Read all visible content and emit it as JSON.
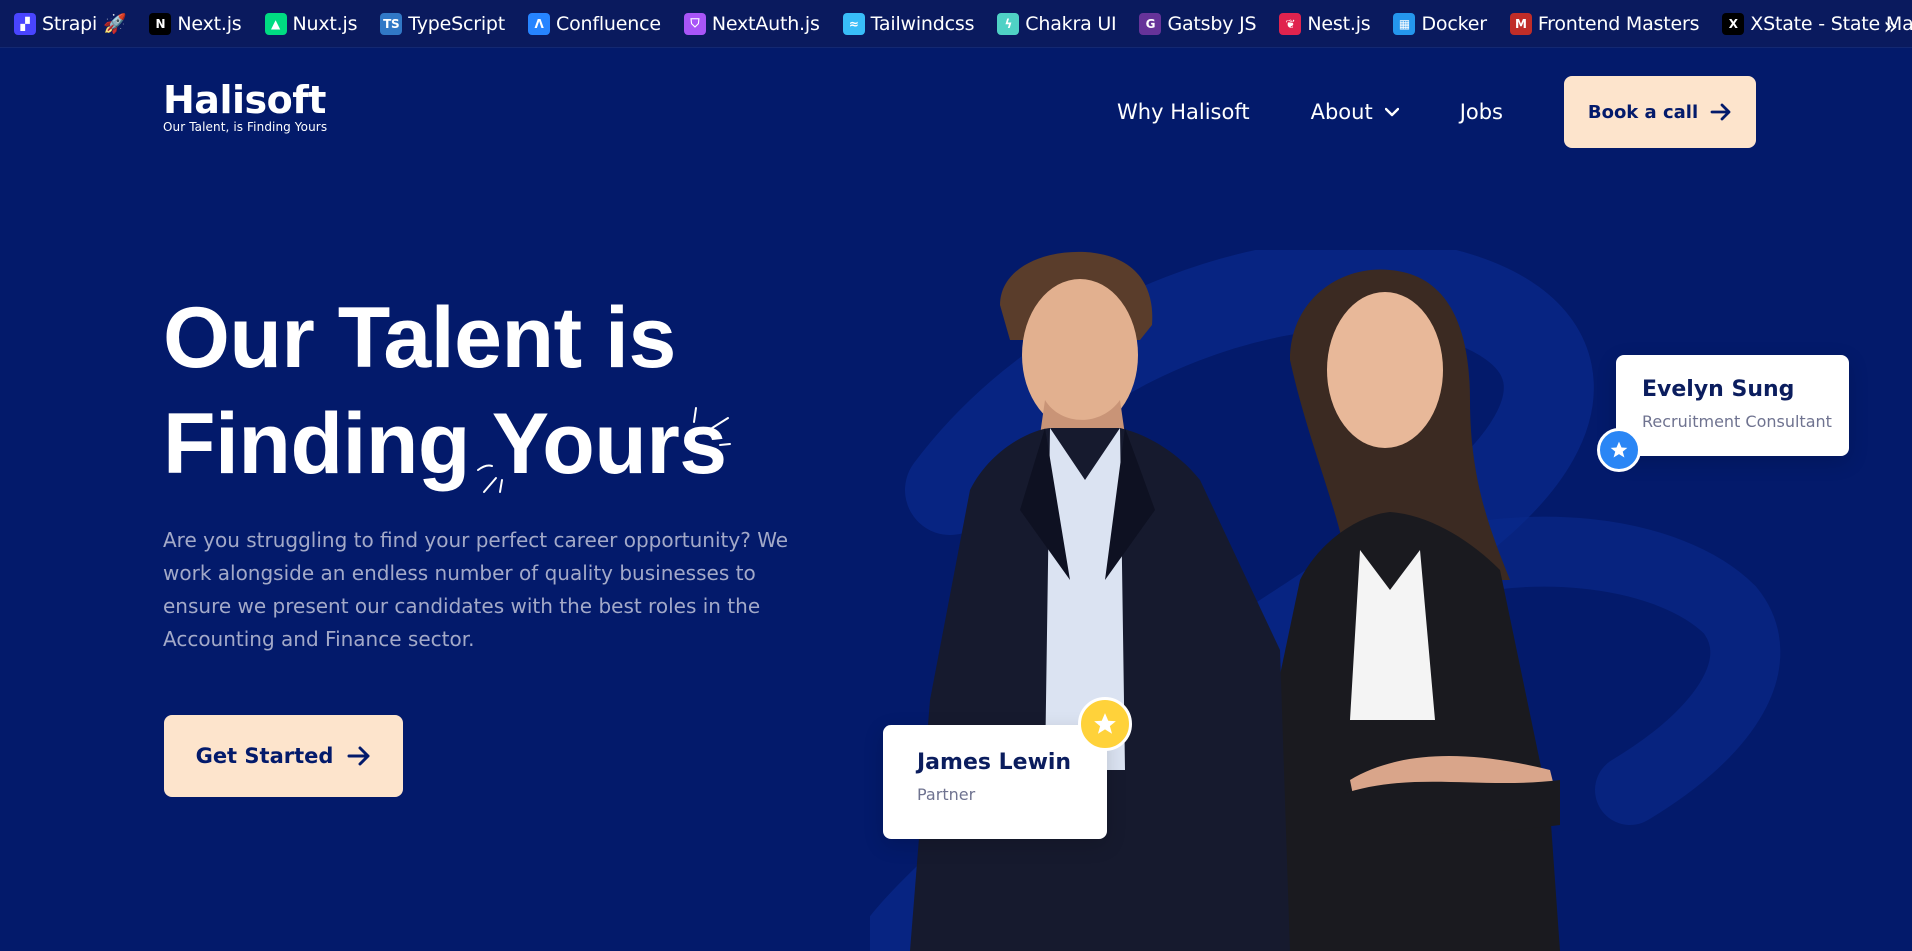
{
  "bookmarks": [
    {
      "label": "Strapi 🚀",
      "icon": "strapi-icon",
      "color": "#4945ff",
      "glyph": "▞"
    },
    {
      "label": "Next.js",
      "icon": "nextjs-icon",
      "color": "#000000",
      "glyph": "N"
    },
    {
      "label": "Nuxt.js",
      "icon": "nuxt-icon",
      "color": "#00dc82",
      "glyph": "▲"
    },
    {
      "label": "TypeScript",
      "icon": "typescript-icon",
      "color": "#3178c6",
      "glyph": "TS"
    },
    {
      "label": "Confluence",
      "icon": "confluence-icon",
      "color": "#2684ff",
      "glyph": "Ʌ"
    },
    {
      "label": "NextAuth.js",
      "icon": "nextauth-icon",
      "color": "#a855f7",
      "glyph": "⛉"
    },
    {
      "label": "Tailwindcss",
      "icon": "tailwind-icon",
      "color": "#38bdf8",
      "glyph": "≈"
    },
    {
      "label": "Chakra UI",
      "icon": "chakra-icon",
      "color": "#4fd1c5",
      "glyph": "ϟ"
    },
    {
      "label": "Gatsby JS",
      "icon": "gatsby-icon",
      "color": "#663399",
      "glyph": "G"
    },
    {
      "label": "Nest.js",
      "icon": "nestjs-icon",
      "color": "#e0234e",
      "glyph": "❦"
    },
    {
      "label": "Docker",
      "icon": "docker-icon",
      "color": "#2496ed",
      "glyph": "▦"
    },
    {
      "label": "Frontend Masters",
      "icon": "frontend-masters-icon",
      "color": "#c02d28",
      "glyph": "M"
    },
    {
      "label": "XState - State Machin...",
      "icon": "xstate-icon",
      "color": "#000000",
      "glyph": "X"
    }
  ],
  "bookmarks_more": "»",
  "header": {
    "logo_name": "Halisoft",
    "logo_tagline": "Our Talent, is Finding Yours",
    "nav": [
      {
        "label": "Why Halisoft"
      },
      {
        "label": "About"
      },
      {
        "label": "Jobs"
      }
    ],
    "book_label": "Book a call"
  },
  "hero": {
    "title_line1": "Our Talent is",
    "title_line2": "Finding Yours",
    "description": "Are you struggling to find your perfect career opportunity? We work alongside an endless number of quality businesses to ensure we present our candidates with the best roles in the Accounting and Finance sector.",
    "cta_label": "Get Started"
  },
  "people": {
    "evelyn": {
      "name": "Evelyn Sung",
      "role": "Recruitment Consultant"
    },
    "james": {
      "name": "James Lewin",
      "role": "Partner"
    }
  },
  "colors": {
    "background": "#031a6b",
    "accent_cta": "#fde4cc",
    "text_muted": "#a3a9c8",
    "badge_blue": "#2a86f5",
    "badge_yellow": "#ffd23a"
  }
}
